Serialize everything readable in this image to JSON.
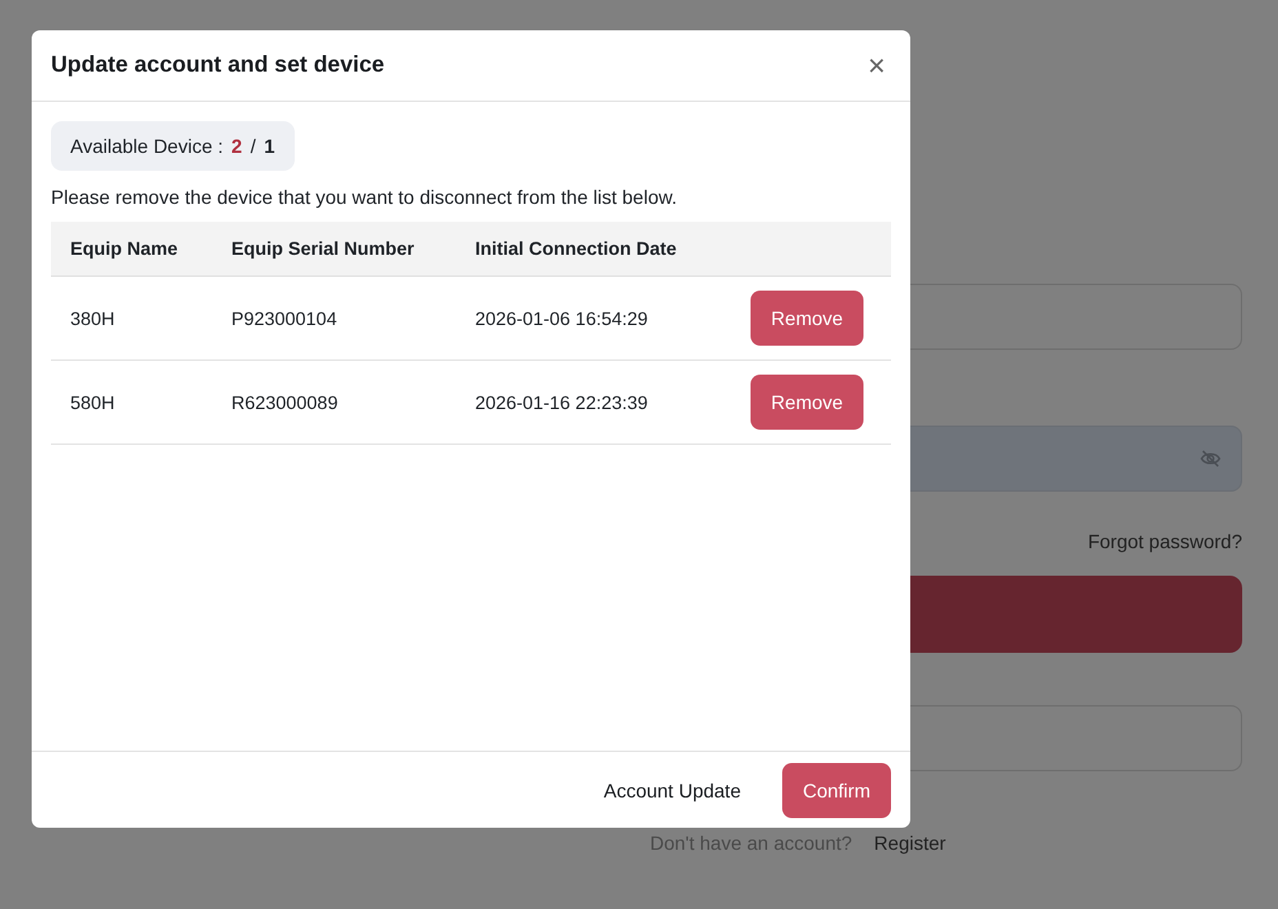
{
  "background": {
    "forgot_password": "Forgot password?",
    "register_prompt": "Don't have an account?",
    "register_link": "Register"
  },
  "modal": {
    "title": "Update account and set device",
    "close": "×",
    "available_device": {
      "label": "Available Device :",
      "used": "2",
      "separator": "/",
      "limit": "1"
    },
    "instruction": "Please remove the device that you want to disconnect from the list below.",
    "table": {
      "columns": [
        "Equip Name",
        "Equip Serial Number",
        "Initial Connection Date"
      ],
      "rows": [
        {
          "name": "380H",
          "serial": "P923000104",
          "date": "2026-01-06 16:54:29",
          "action": "Remove"
        },
        {
          "name": "580H",
          "serial": "R623000089",
          "date": "2026-01-16 22:23:39",
          "action": "Remove"
        }
      ]
    },
    "footer": {
      "secondary": "Account Update",
      "primary": "Confirm"
    }
  }
}
